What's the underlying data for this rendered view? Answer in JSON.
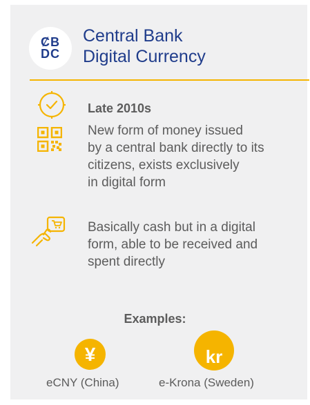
{
  "header": {
    "logo_top": "ȻB",
    "logo_bottom": "DC",
    "title_line1": "Central Bank",
    "title_line2": "Digital Currency"
  },
  "rows": {
    "period": "Late 2010s",
    "description_lines": [
      "New form of money issued",
      "by a central bank directly to its",
      "citizens, exists exclusively",
      "in digital form"
    ],
    "usage_lines": [
      "Basically cash but in a digital",
      "form, able to be received and",
      "spent directly"
    ]
  },
  "examples": {
    "heading": "Examples:",
    "items": [
      {
        "symbol": "¥",
        "label": "eCNY (China)"
      },
      {
        "symbol": "kr",
        "label": "e-Krona (Sweden)"
      }
    ]
  },
  "colors": {
    "accent": "#f5b400",
    "title": "#1f3c8b",
    "background": "#f0f0f1",
    "text": "#5c5c5c"
  },
  "icons": [
    "clock-check-icon",
    "qr-code-icon",
    "hand-card-payment-icon"
  ]
}
